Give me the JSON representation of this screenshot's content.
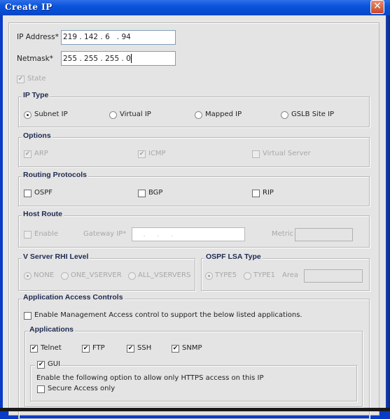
{
  "window": {
    "title": "Create IP",
    "close_glyph": "✕"
  },
  "ip_address": {
    "label": "IP Address*",
    "value": "219 . 142 . 6   . 94"
  },
  "netmask": {
    "label": "Netmask*",
    "value": "255 . 255 . 255 . 0"
  },
  "state": {
    "label": "State",
    "checked": true,
    "enabled": false
  },
  "ip_type": {
    "title": "IP Type",
    "options": [
      {
        "label": "Subnet IP",
        "selected": true
      },
      {
        "label": "Virtual IP",
        "selected": false
      },
      {
        "label": "Mapped IP",
        "selected": false
      },
      {
        "label": "GSLB Site IP",
        "selected": false
      }
    ]
  },
  "options": {
    "title": "Options",
    "items": [
      {
        "label": "ARP",
        "checked": true,
        "enabled": false
      },
      {
        "label": "ICMP",
        "checked": true,
        "enabled": false
      },
      {
        "label": "Virtual Server",
        "checked": false,
        "enabled": false
      }
    ]
  },
  "routing_protocols": {
    "title": "Routing Protocols",
    "items": [
      {
        "label": "OSPF",
        "checked": false
      },
      {
        "label": "BGP",
        "checked": false
      },
      {
        "label": "RIP",
        "checked": false
      }
    ]
  },
  "host_route": {
    "title": "Host Route",
    "enable_label": "Enable",
    "gateway_label": "Gateway IP*",
    "gateway_value": "    .     .     .",
    "metric_label": "Metric",
    "metric_value": ""
  },
  "vserver_rhi": {
    "title": "V Server RHI Level",
    "options": [
      {
        "label": "NONE",
        "selected": true
      },
      {
        "label": "ONE_VSERVER",
        "selected": false
      },
      {
        "label": "ALL_VSERVERS",
        "selected": false
      }
    ]
  },
  "ospf_lsa": {
    "title": "OSPF LSA Type",
    "options": [
      {
        "label": "TYPE5",
        "selected": true
      },
      {
        "label": "TYPE1",
        "selected": false
      }
    ],
    "area_label": "Area",
    "area_value": ""
  },
  "app_access": {
    "title": "Application Access Controls",
    "enable_label": "Enable Management Access control to support the below listed applications.",
    "enable_checked": false,
    "applications": {
      "title": "Applications",
      "items": [
        {
          "label": "Telnet",
          "checked": true
        },
        {
          "label": "FTP",
          "checked": true
        },
        {
          "label": "SSH",
          "checked": true
        },
        {
          "label": "SNMP",
          "checked": true
        }
      ],
      "gui": {
        "label": "GUI",
        "checked": true,
        "description": "Enable the following option to allow only HTTPS access on this IP",
        "secure_label": "Secure Access only",
        "secure_checked": false
      }
    }
  },
  "glyphs": {
    "check": "✔"
  }
}
